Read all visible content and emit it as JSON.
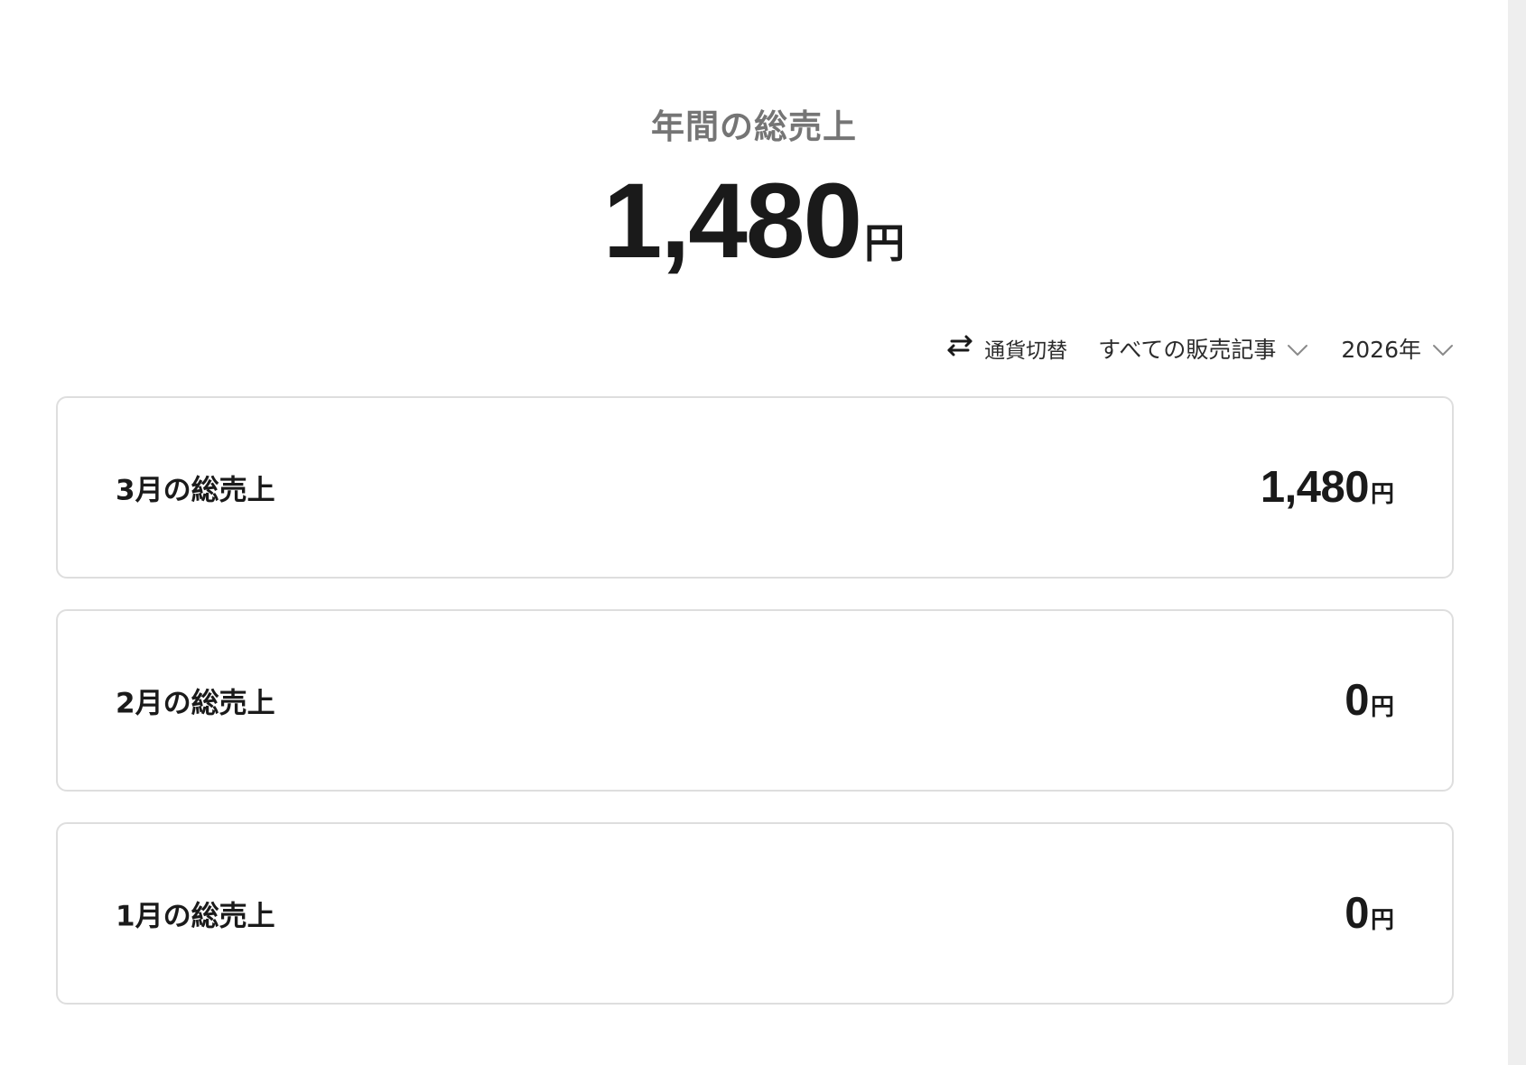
{
  "annual": {
    "title": "年間の総売上",
    "amount": "1,480",
    "unit": "円"
  },
  "toolbar": {
    "currency_toggle_label": "通貨切替",
    "currency_toggle_icon": "swap-arrows-icon",
    "article_filter": {
      "selected": "すべての販売記事",
      "icon": "chevron-down-icon"
    },
    "year_filter": {
      "selected": "2026年",
      "icon": "chevron-down-icon"
    }
  },
  "months": [
    {
      "label": "3月の総売上",
      "amount": "1,480",
      "unit": "円"
    },
    {
      "label": "2月の総売上",
      "amount": "0",
      "unit": "円"
    },
    {
      "label": "1月の総売上",
      "amount": "0",
      "unit": "円"
    }
  ],
  "colors": {
    "text_primary": "#1a1a1a",
    "text_muted": "#757575",
    "card_border": "#dedede",
    "background": "#ffffff"
  }
}
